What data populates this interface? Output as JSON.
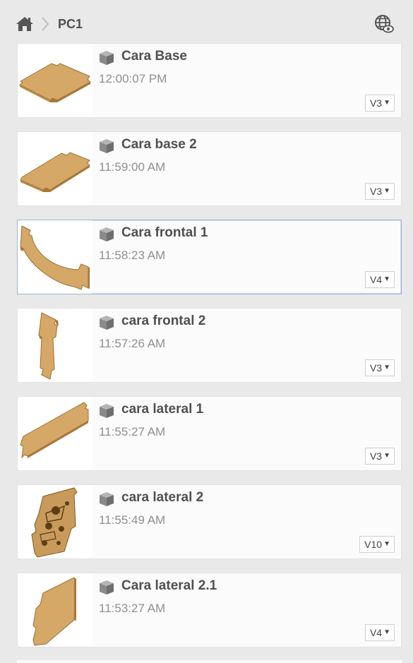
{
  "header": {
    "breadcrumb_current": "PC1",
    "home_icon": "home-icon",
    "chevron_icon": "chevron-right-icon",
    "visibility_icon": "globe-eye-icon"
  },
  "colors": {
    "background": "#e9e9e9",
    "card": "#fbfbfb",
    "selected_border": "#9fb6d2",
    "wood": "#d6a867",
    "wood_dark": "#9c6f35"
  },
  "items": [
    {
      "title": "Cara Base",
      "time": "12:00:07 PM",
      "version": "V3",
      "icon": "cube-icon",
      "selected": false
    },
    {
      "title": "Cara base 2",
      "time": "11:59:00 AM",
      "version": "V3",
      "icon": "cube-icon",
      "selected": false
    },
    {
      "title": "Cara frontal 1",
      "time": "11:58:23 AM",
      "version": "V4",
      "icon": "cube-icon",
      "selected": true
    },
    {
      "title": "cara frontal 2",
      "time": "11:57:26 AM",
      "version": "V3",
      "icon": "cube-icon",
      "selected": false
    },
    {
      "title": "cara lateral 1",
      "time": "11:55:27 AM",
      "version": "V3",
      "icon": "cube-icon",
      "selected": false
    },
    {
      "title": "cara lateral 2",
      "time": "11:55:49 AM",
      "version": "V10",
      "icon": "cube-icon",
      "selected": false
    },
    {
      "title": "Cara lateral 2.1",
      "time": "11:53:27 AM",
      "version": "V4",
      "icon": "cube-icon",
      "selected": false
    }
  ]
}
